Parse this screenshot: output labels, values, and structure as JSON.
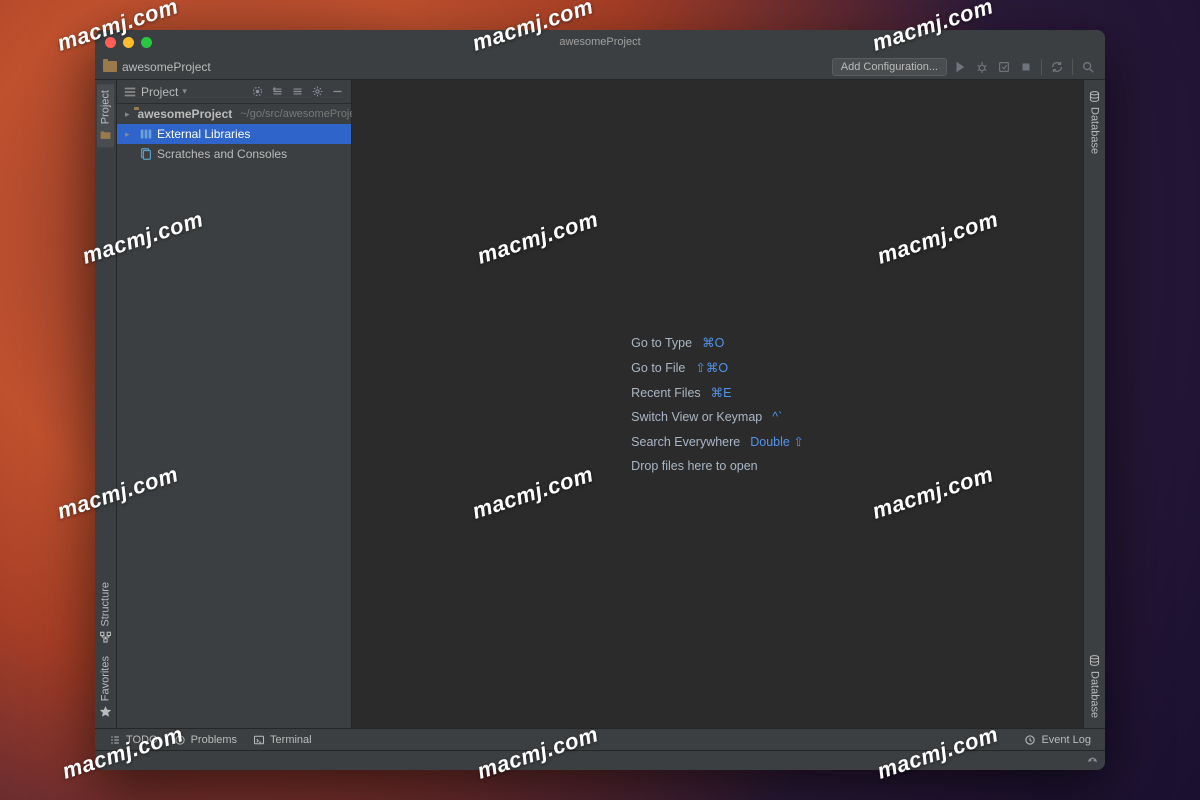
{
  "window": {
    "title": "awesomeProject"
  },
  "breadcrumb": {
    "project": "awesomeProject"
  },
  "toolbar": {
    "add_config": "Add Configuration..."
  },
  "left_gutter": {
    "project": "Project",
    "structure": "Structure",
    "favorites": "Favorites"
  },
  "right_gutter": {
    "database": "Database",
    "database2": "Database"
  },
  "proj_panel": {
    "header": "Project",
    "root": "awesomeProject",
    "root_path": "~/go/src/awesomeProject",
    "ext_libs": "External Libraries",
    "scratches": "Scratches and Consoles"
  },
  "welcome": {
    "items": [
      {
        "label": "Go to Type",
        "kb": "⌘O"
      },
      {
        "label": "Go to File",
        "kb": "⇧⌘O"
      },
      {
        "label": "Recent Files",
        "kb": "⌘E"
      },
      {
        "label": "Switch View or Keymap",
        "kb": "^`"
      },
      {
        "label": "Search Everywhere",
        "kb": "Double ⇧"
      },
      {
        "label": "Drop files here to open",
        "kb": ""
      }
    ]
  },
  "bottombar": {
    "todo": "TODO",
    "problems": "Problems",
    "terminal": "Terminal",
    "eventlog": "Event Log"
  },
  "watermark": "macmj.com"
}
